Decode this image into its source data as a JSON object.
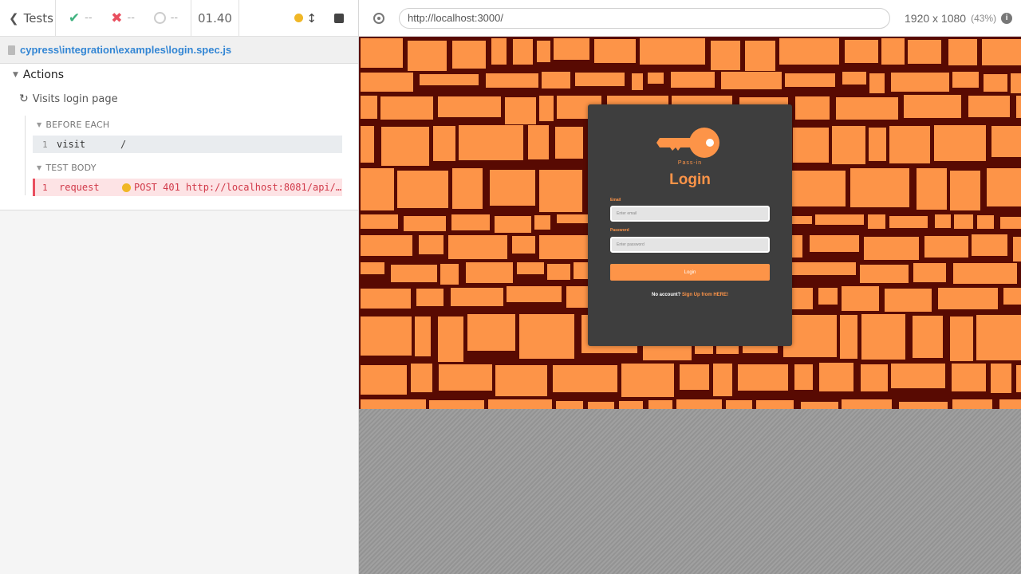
{
  "reporter": {
    "tests_label": "Tests",
    "stats": {
      "passed": "--",
      "failed": "--",
      "pending": "--"
    },
    "duration": "01.40",
    "spec_path": "cypress\\integration\\examples\\login.spec.js",
    "suite": "Actions",
    "test": "Visits login page",
    "before_each_label": "BEFORE EACH",
    "test_body_label": "TEST BODY",
    "commands": [
      {
        "num": "1",
        "name": "visit",
        "message": "/"
      },
      {
        "num": "1",
        "name": "request",
        "message": "POST 401 http://localhost:8081/api/v1/…"
      }
    ]
  },
  "aut": {
    "url": "http://localhost:3000/",
    "viewport": "1920 x 1080",
    "scale": "(43%)",
    "login": {
      "brand": "Pass-in",
      "title": "Login",
      "email_label": "Email",
      "email_placeholder": "Enter email",
      "password_label": "Password",
      "password_placeholder": "Enter password",
      "button": "Login",
      "signup_prefix": "No account?",
      "signup_link": "Sign Up from HERE!"
    }
  },
  "colors": {
    "accent": "#fd9448",
    "background": "#580a02",
    "card": "#3e3e3e",
    "link": "#3386d4",
    "error": "#e94f5f"
  }
}
